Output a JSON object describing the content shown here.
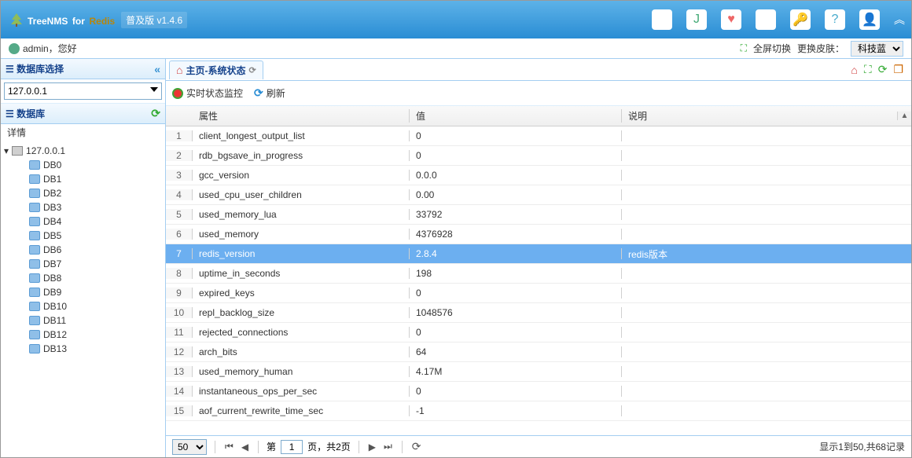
{
  "header": {
    "brand_a": "TreeNMS",
    "brand_b": "for",
    "brand_c": "Redis",
    "version": "普及版 v1.4.6"
  },
  "subheader": {
    "user": "admin，您好",
    "fullscreen": "全屏切换",
    "skin_label": "更换皮肤：",
    "skin_value": "科技蓝"
  },
  "sidebar": {
    "db_select": "数据库选择",
    "host": "127.0.0.1",
    "db_label": "数据库",
    "detail": "详情",
    "root": "127.0.0.1",
    "dbs": [
      "DB0",
      "DB1",
      "DB2",
      "DB3",
      "DB4",
      "DB5",
      "DB6",
      "DB7",
      "DB8",
      "DB9",
      "DB10",
      "DB11",
      "DB12",
      "DB13"
    ]
  },
  "tab": {
    "title": "主页-系统状态"
  },
  "toolbar": {
    "monitor": "实时状态监控",
    "refresh": "刷新"
  },
  "grid": {
    "col_attr": "属性",
    "col_val": "值",
    "col_desc": "说明",
    "rows": [
      {
        "n": "1",
        "attr": "client_longest_output_list",
        "val": "0",
        "desc": ""
      },
      {
        "n": "2",
        "attr": "rdb_bgsave_in_progress",
        "val": "0",
        "desc": ""
      },
      {
        "n": "3",
        "attr": "gcc_version",
        "val": "0.0.0",
        "desc": ""
      },
      {
        "n": "4",
        "attr": "used_cpu_user_children",
        "val": "0.00",
        "desc": ""
      },
      {
        "n": "5",
        "attr": "used_memory_lua",
        "val": "33792",
        "desc": ""
      },
      {
        "n": "6",
        "attr": "used_memory",
        "val": "4376928",
        "desc": ""
      },
      {
        "n": "7",
        "attr": "redis_version",
        "val": "2.8.4",
        "desc": "redis版本"
      },
      {
        "n": "8",
        "attr": "uptime_in_seconds",
        "val": "198",
        "desc": ""
      },
      {
        "n": "9",
        "attr": "expired_keys",
        "val": "0",
        "desc": ""
      },
      {
        "n": "10",
        "attr": "repl_backlog_size",
        "val": "1048576",
        "desc": ""
      },
      {
        "n": "11",
        "attr": "rejected_connections",
        "val": "0",
        "desc": ""
      },
      {
        "n": "12",
        "attr": "arch_bits",
        "val": "64",
        "desc": ""
      },
      {
        "n": "13",
        "attr": "used_memory_human",
        "val": "4.17M",
        "desc": ""
      },
      {
        "n": "14",
        "attr": "instantaneous_ops_per_sec",
        "val": "0",
        "desc": ""
      },
      {
        "n": "15",
        "attr": "aof_current_rewrite_time_sec",
        "val": "-1",
        "desc": ""
      }
    ],
    "selected_index": 6
  },
  "pager": {
    "page_size": "50",
    "prefix": "第",
    "page": "1",
    "total_pages": "页，共2页",
    "summary": "显示1到50,共68记录"
  }
}
